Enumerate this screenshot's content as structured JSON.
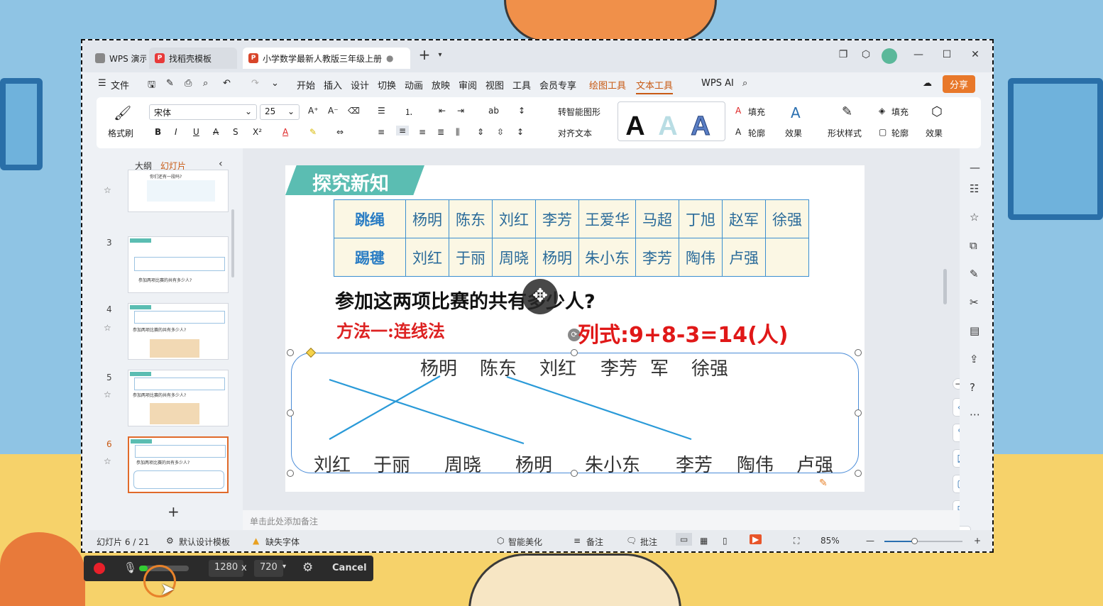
{
  "window_tabs": [
    {
      "label": "WPS 演示",
      "icon": "wps-logo-icon"
    },
    {
      "label": "找稻壳模板",
      "icon": "docer-icon"
    },
    {
      "label": "小学数学最新人教版三年级上册",
      "icon": "ppt-file-icon"
    }
  ],
  "menu": {
    "file": "文件",
    "items": [
      "开始",
      "插入",
      "设计",
      "切换",
      "动画",
      "放映",
      "审阅",
      "视图",
      "工具",
      "会员专享"
    ],
    "drawing_tools": "绘图工具",
    "text_tools": "文本工具",
    "wps_ai": "WPS AI",
    "share": "分享"
  },
  "ribbon": {
    "format_painter": "格式刷",
    "font_name": "宋体",
    "font_size": "25",
    "smart_shape": "转智能图形",
    "align_text": "对齐文本",
    "fill": "填充",
    "outline": "轮廓",
    "effect": "效果",
    "shape_style": "形状样式",
    "fill2": "填充",
    "outline2": "轮廓",
    "effect2": "效果",
    "text_styles": [
      "A",
      "A",
      "A"
    ]
  },
  "left_panel": {
    "tab_outline": "大纲",
    "tab_slides": "幻灯片",
    "thumbs": [
      {
        "num": "",
        "title": "你们还有一段吗?"
      },
      {
        "num": "3",
        "title": "参加两项比赛的共有多少人?"
      },
      {
        "num": "4",
        "title": "参加两项比赛的共有多少人?"
      },
      {
        "num": "5",
        "title": "参加两项比赛的共有多少人?"
      },
      {
        "num": "6",
        "title": "参加两项比赛的共有多少人?"
      }
    ]
  },
  "slide": {
    "banner": "探究新知",
    "table": {
      "rows": [
        {
          "label": "跳绳",
          "names": [
            "杨明",
            "陈东",
            "刘红",
            "李芳",
            "王爱华",
            "马超",
            "丁旭",
            "赵军",
            "徐强"
          ]
        },
        {
          "label": "踢毽",
          "names": [
            "刘红",
            "于丽",
            "周晓",
            "杨明",
            "朱小东",
            "李芳",
            "陶伟",
            "卢强",
            ""
          ]
        }
      ]
    },
    "question": "参加这两项比赛的共有多少人?",
    "method": "方法一:连线法",
    "formula": "列式:9+8-3=14(人)",
    "top_names": [
      "杨明",
      "陈东",
      "刘红",
      "李芳",
      "军",
      "徐强"
    ],
    "bottom_names": [
      "刘红",
      "于丽",
      "周晓",
      "杨明",
      "朱小东",
      "李芳",
      "陶伟",
      "卢强"
    ]
  },
  "notes_placeholder": "单击此处添加备注",
  "status": {
    "slide_count": "幻灯片 6 / 21",
    "template": "默认设计模板",
    "missing_font": "缺失字体",
    "smart_beautify": "智能美化",
    "notes": "备注",
    "comments": "批注",
    "zoom": "85%"
  },
  "recorder": {
    "width": "1280",
    "x": "x",
    "height": "720",
    "cancel": "Cancel"
  },
  "colors": {
    "accent": "#c85a14",
    "banner": "#5bbdb2",
    "table_border": "#3b8fd0",
    "formula_red": "#e01818",
    "line_blue": "#2a9ad8"
  }
}
